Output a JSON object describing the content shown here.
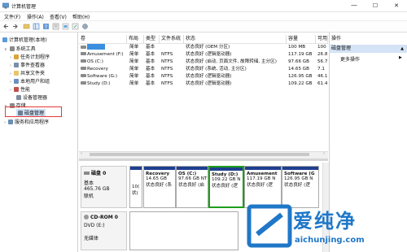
{
  "window": {
    "title": "计算机管理",
    "minimize": "—",
    "maximize": "☐",
    "close": "✕"
  },
  "menu": [
    "文件(F)",
    "操作(A)",
    "查看(V)",
    "帮助(H)"
  ],
  "tree": {
    "root": "计算机管理(本地)",
    "system_tools": "系统工具",
    "task_scheduler": "任务计划程序",
    "event_viewer": "事件查看器",
    "shared_folders": "共享文件夹",
    "local_users": "本地用户和组",
    "performance": "性能",
    "device_manager": "设备管理器",
    "storage": "存储",
    "disk_management": "磁盘管理",
    "services": "服务和应用程序"
  },
  "columns": [
    "卷",
    "布局",
    "类型",
    "文件系统",
    "状态",
    "容量",
    "可用"
  ],
  "volumes": [
    {
      "name": "",
      "layout": "简单",
      "type": "基本",
      "fs": "",
      "status": "状态良好 (OEM 分区)",
      "capacity": "100 MB",
      "free": "100"
    },
    {
      "name": "Amusement (F:)",
      "layout": "简单",
      "type": "基本",
      "fs": "NTFS",
      "status": "状态良好 (逻辑驱动器)",
      "capacity": "117.19 GB",
      "free": "26.8"
    },
    {
      "name": "OS (C:)",
      "layout": "简单",
      "type": "基本",
      "fs": "NTFS",
      "status": "状态良好 (启动, 页面文件, 故障转储, 主分区)",
      "capacity": "97.66 GB",
      "free": "56.7"
    },
    {
      "name": "Recovery",
      "layout": "简单",
      "type": "基本",
      "fs": "NTFS",
      "status": "状态良好 (系统, 活动, 主分区)",
      "capacity": "14.65 GB",
      "free": "7.1"
    },
    {
      "name": "Software (G:)",
      "layout": "简单",
      "type": "基本",
      "fs": "NTFS",
      "status": "状态良好 (逻辑驱动器)",
      "capacity": "126.95 GB",
      "free": "46.1"
    },
    {
      "name": "Study (D:)",
      "layout": "简单",
      "type": "基本",
      "fs": "NTFS",
      "status": "状态良好 (逻辑驱动器)",
      "capacity": "109.22 GB",
      "free": "61.4"
    }
  ],
  "disk0": {
    "name": "磁盘 0",
    "type": "基本",
    "size": "465.76 GB",
    "state": "联机",
    "partitions": [
      {
        "name": "",
        "size": "10(",
        "status": "状("
      },
      {
        "name": "Recovery",
        "size": "14.65 GB",
        "status": "状态良好 (系"
      },
      {
        "name": "OS (C:)",
        "size": "97.66 GB NT",
        "status": "状态良好 (启"
      },
      {
        "name": "Study (D:)",
        "size": "109.22 GB N",
        "status": "状态良好 (逻"
      },
      {
        "name": "Amusement",
        "size": "117.19 GB N",
        "status": "状态良好 (逻"
      },
      {
        "name": "Software (G",
        "size": "126.95 GB N",
        "status": "状态良好 (逻"
      }
    ]
  },
  "cdrom": {
    "name": "CD-ROM 0",
    "drive": "DVD (E:)",
    "media": "无媒体"
  },
  "actions": {
    "header": "操作",
    "selected": "磁盘管理",
    "more": "更多操作"
  },
  "watermark": {
    "brand": "爱纯净",
    "url": "aichunjing.com"
  },
  "colors": {
    "partition_bar": "#1f3f8f",
    "selected_border": "#1d9e1d",
    "highlight": "#e53935",
    "selection": "#d4e3f5",
    "watermark": "#1f77c8"
  }
}
